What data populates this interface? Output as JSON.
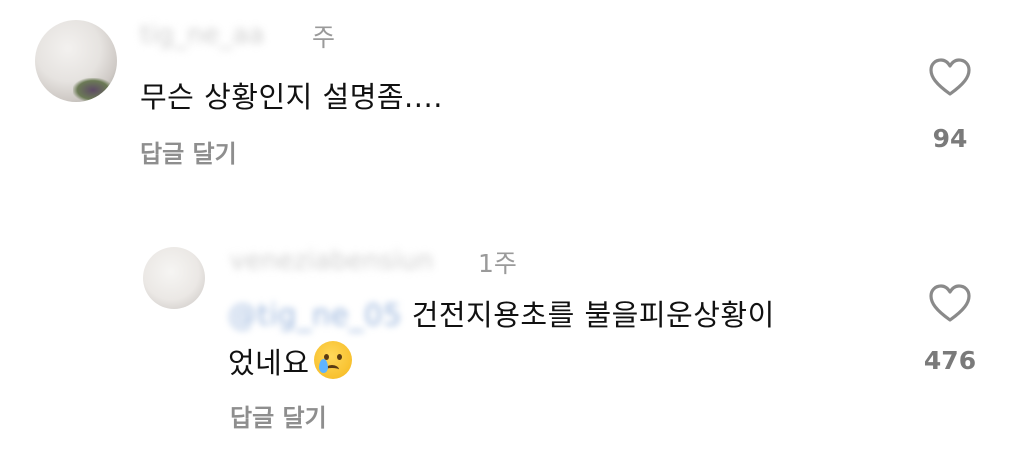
{
  "comment1": {
    "username": "tig_ne_aa",
    "time": "주",
    "text": "무슨 상황인지 설명좀....",
    "reply_label": "답글 달기",
    "likes": "94"
  },
  "comment2": {
    "username": "veneziabensiun",
    "time": "1주",
    "mention": "@tig_ne_05",
    "text": "건전지용초를 불을피운상황이",
    "text_line2": "었네요",
    "reply_label": "답글 달기",
    "likes": "476",
    "emoji": "crying-face-emoji"
  },
  "colors": {
    "accent_mention": "#2f5fa8",
    "muted": "#8e8e8e",
    "text": "#111111"
  }
}
